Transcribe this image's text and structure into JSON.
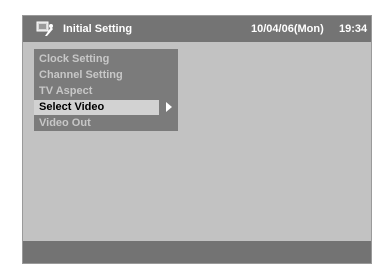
{
  "header": {
    "icon": "settings-icon",
    "title": "Initial Setting",
    "date": "10/04/06(Mon)",
    "time": "19:34"
  },
  "menu": {
    "items": [
      {
        "label": "Clock Setting"
      },
      {
        "label": "Channel Setting"
      },
      {
        "label": "TV Aspect"
      },
      {
        "label": "Select Video",
        "selected": true
      },
      {
        "label": "Video Out"
      }
    ]
  },
  "colors": {
    "screen_background": "#c2c2c2",
    "title_bar": "#747474",
    "menu_panel": "#7b7b7b",
    "menu_text": "#c7c7c7",
    "selected_highlight": "#d2d2d2"
  }
}
